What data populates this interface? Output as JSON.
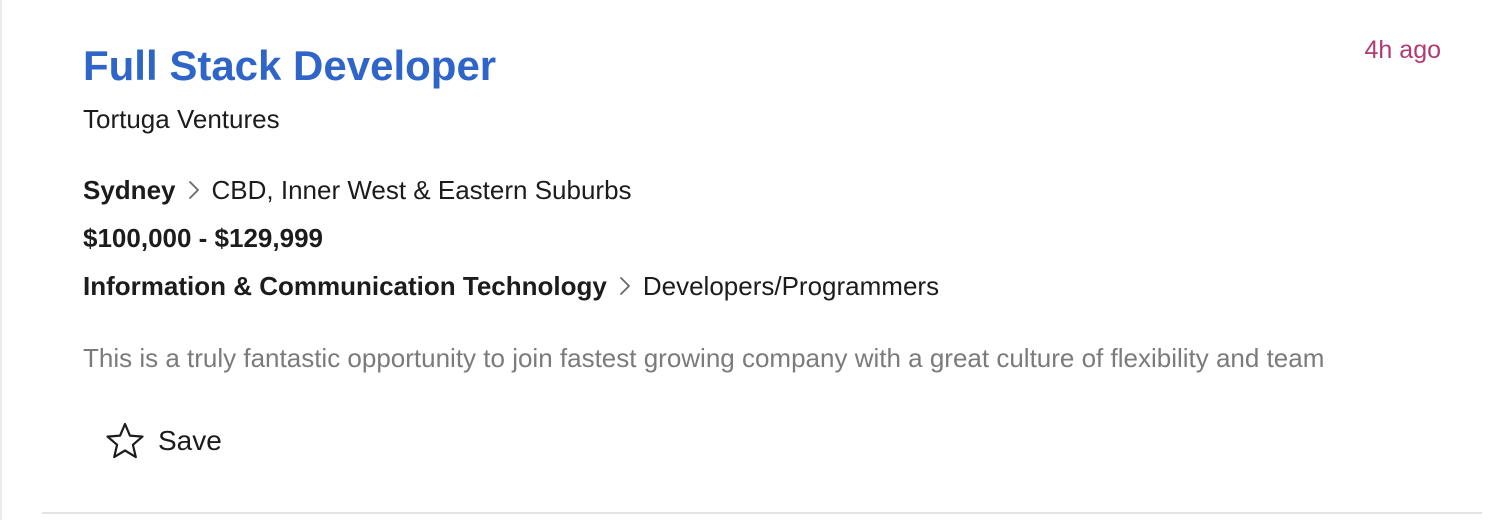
{
  "job": {
    "title": "Full Stack Developer",
    "posted": "4h ago",
    "company": "Tortuga Ventures",
    "location": {
      "city": "Sydney",
      "area": "CBD, Inner West & Eastern Suburbs"
    },
    "salary": "$100,000 - $129,999",
    "classification": {
      "category": "Information & Communication Technology",
      "subcategory": "Developers/Programmers"
    },
    "teaser": "This is a truly fantastic opportunity to join fastest growing company with a great culture of flexibility and team",
    "save_label": "Save"
  },
  "icons": {
    "chevron": "chevron-right-icon",
    "save": "star-outline-icon"
  },
  "colors": {
    "title": "#2f64c9",
    "posted": "#b23a73",
    "text": "#1c1c1c",
    "teaser": "#7b7b7b"
  }
}
